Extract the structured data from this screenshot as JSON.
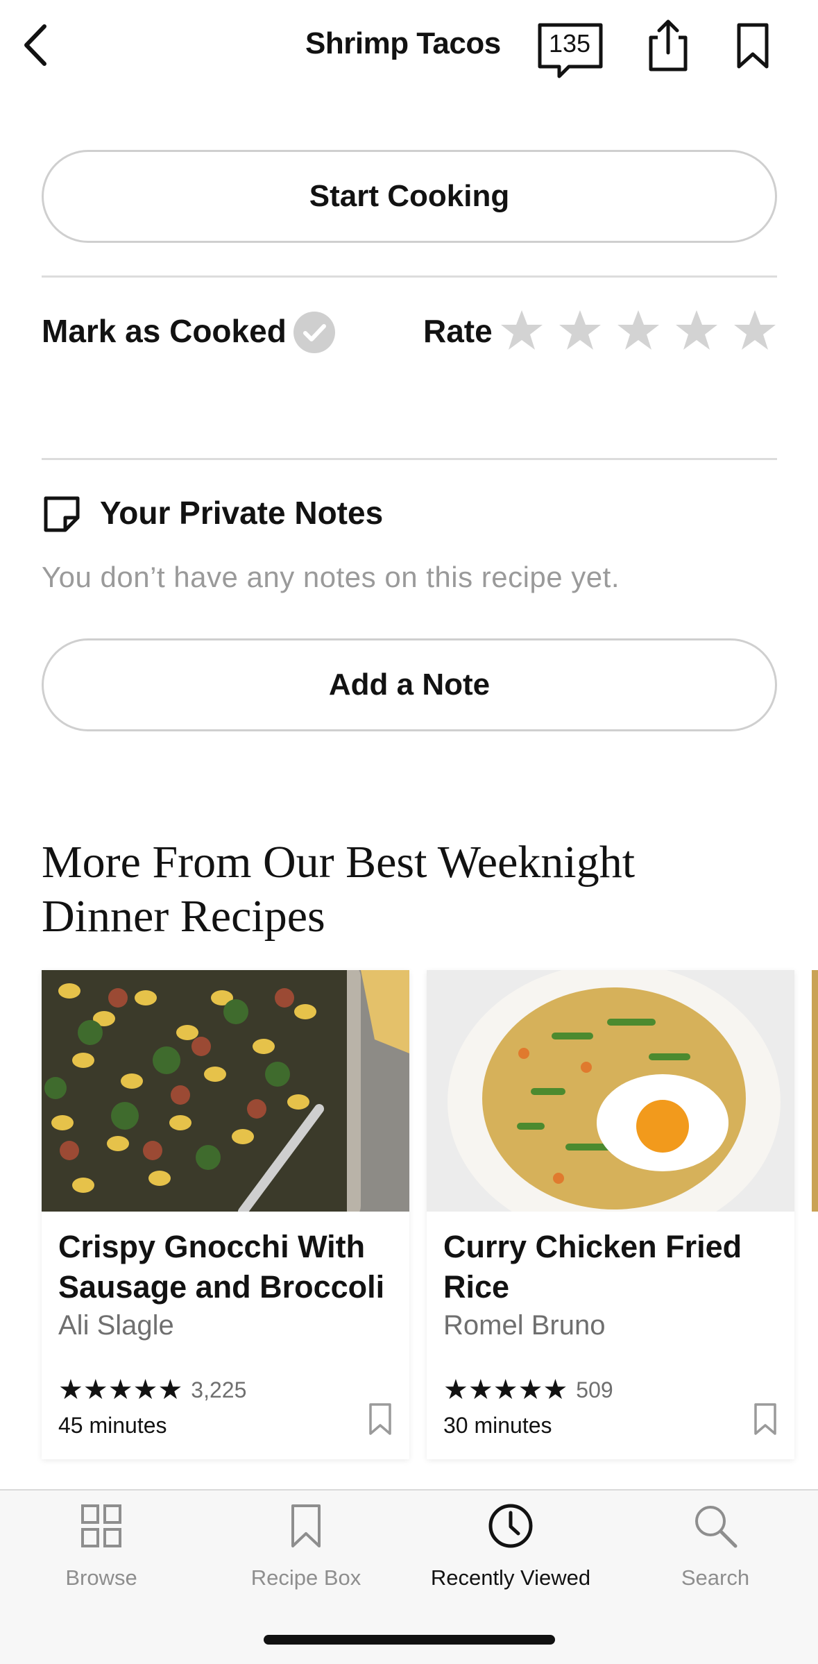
{
  "header": {
    "title": "Shrimp Tacos",
    "comment_count": "135"
  },
  "actions": {
    "start_cooking": "Start Cooking",
    "mark_as_cooked": "Mark as Cooked",
    "rate_label": "Rate",
    "rating_value": 0,
    "rating_max": 5
  },
  "notes": {
    "heading": "Your Private Notes",
    "empty_text": "You don’t have any notes on this recipe yet.",
    "add_note": "Add a Note"
  },
  "more": {
    "title": "More From Our Best Weeknight Dinner Recipes",
    "cards": [
      {
        "title": "Crispy Gnocchi With Sausage and Broccoli",
        "author": "Ali Slagle",
        "stars": "★★★★★",
        "rating_count": "3,225",
        "time": "45 minutes"
      },
      {
        "title": "Curry Chicken Fried Rice",
        "author": "Romel Bruno",
        "stars": "★★★★★",
        "rating_count": "509",
        "time": "30 minutes"
      }
    ]
  },
  "tabbar": {
    "tabs": [
      {
        "label": "Browse",
        "icon": "grid-icon",
        "active": false
      },
      {
        "label": "Recipe Box",
        "icon": "bookmark-icon",
        "active": false
      },
      {
        "label": "Recently Viewed",
        "icon": "clock-icon",
        "active": true
      },
      {
        "label": "Search",
        "icon": "search-icon",
        "active": false
      }
    ]
  },
  "colors": {
    "text": "#121212",
    "muted": "#9a9a9a",
    "star_empty": "#d3d3d3",
    "check_circle": "#cfcfcf"
  }
}
